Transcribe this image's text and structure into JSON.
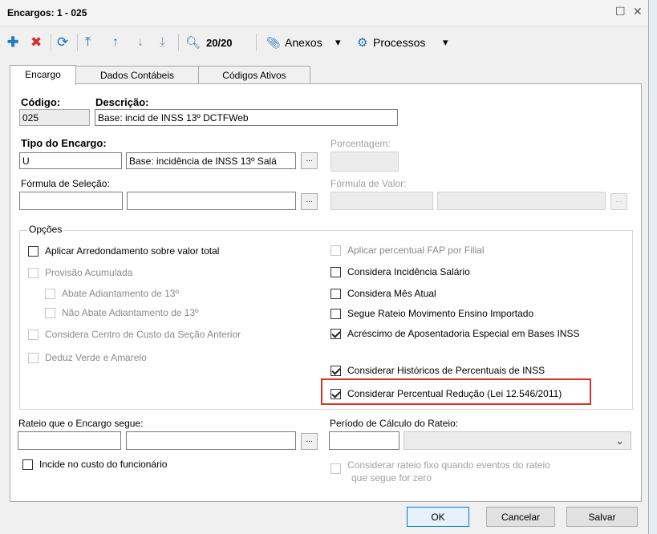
{
  "window": {
    "title": "Encargos: 1 - 025",
    "maximize_glyph": "☐",
    "close_glyph": "✕"
  },
  "toolbar": {
    "add_glyph": "✚",
    "delete_glyph": "✖",
    "refresh_glyph": "⟳",
    "first_glyph": "⤒",
    "prev_glyph": "↑",
    "next_glyph": "↓",
    "last_glyph": "⤓",
    "search_glyph": "🔍︎",
    "record_counter": "20/20",
    "attachments_label": "Anexos",
    "attachments_glyph": "📎︎",
    "processes_label": "Processos",
    "processes_glyph": "⚙",
    "dropdown_glyph": "▾",
    "colors": {
      "add": "#1e7bc4",
      "delete": "#d32f2f",
      "nav": "#1e6fb8"
    }
  },
  "tabs": [
    {
      "label": "Encargo",
      "active": true
    },
    {
      "label": "Dados Contábeis",
      "active": false
    },
    {
      "label": "Códigos Ativos",
      "active": false
    }
  ],
  "form": {
    "codigo_label": "Código:",
    "codigo_value": "025",
    "descricao_label": "Descrição:",
    "descricao_value": "Base: incid de INSS 13º DCTFWeb",
    "tipo_label": "Tipo do Encargo:",
    "tipo_code": "U",
    "tipo_desc": "Base: incidência de INSS 13º Salá",
    "porcentagem_label": "Porcentagem:",
    "formula_selecao_label": "Fórmula de Seleção:",
    "formula_valor_label": "Fórmula de Valor:",
    "ellipsis": "..."
  },
  "options": {
    "group_title": "Opções",
    "left": [
      {
        "label": "Aplicar Arredondamento sobre valor total",
        "checked": false,
        "enabled": true
      },
      {
        "label": "Provisão Acumulada",
        "checked": false,
        "enabled": false
      },
      {
        "label": "Abate Adiantamento de 13º",
        "checked": false,
        "enabled": false
      },
      {
        "label": "Não Abate Adiantamento de 13º",
        "checked": false,
        "enabled": false
      },
      {
        "label": "Considera Centro de Custo da Seção Anterior",
        "checked": false,
        "enabled": false
      },
      {
        "label": "Deduz Verde e Amarelo",
        "checked": false,
        "enabled": false
      }
    ],
    "right": [
      {
        "label": "Aplicar percentual FAP por Filial",
        "checked": false,
        "enabled": false
      },
      {
        "label": "Considera Incidência Salário",
        "checked": false,
        "enabled": true
      },
      {
        "label": "Considera Mês Atual",
        "checked": false,
        "enabled": true
      },
      {
        "label": "Segue Rateio Movimento Ensino Importado",
        "checked": false,
        "enabled": true
      },
      {
        "label": "Acréscimo de Aposentadoria Especial em Bases INSS",
        "checked": true,
        "enabled": true
      },
      {
        "label": "Considerar Históricos de Percentuais de INSS",
        "checked": true,
        "enabled": true
      },
      {
        "label": "Considerar Percentual Redução (Lei 12.546/2011)",
        "checked": true,
        "enabled": true,
        "highlighted": true
      }
    ]
  },
  "rateio": {
    "label": "Rateio que o Encargo segue:",
    "periodo_label": "Período de Cálculo do Rateio:",
    "incide_label": "Incide no custo do funcionário",
    "considerar_fixo_label_line1": "Considerar rateio fixo quando eventos do rateio",
    "considerar_fixo_label_line2": "que segue for zero"
  },
  "buttons": {
    "ok": "OK",
    "cancelar": "Cancelar",
    "salvar": "Salvar"
  }
}
